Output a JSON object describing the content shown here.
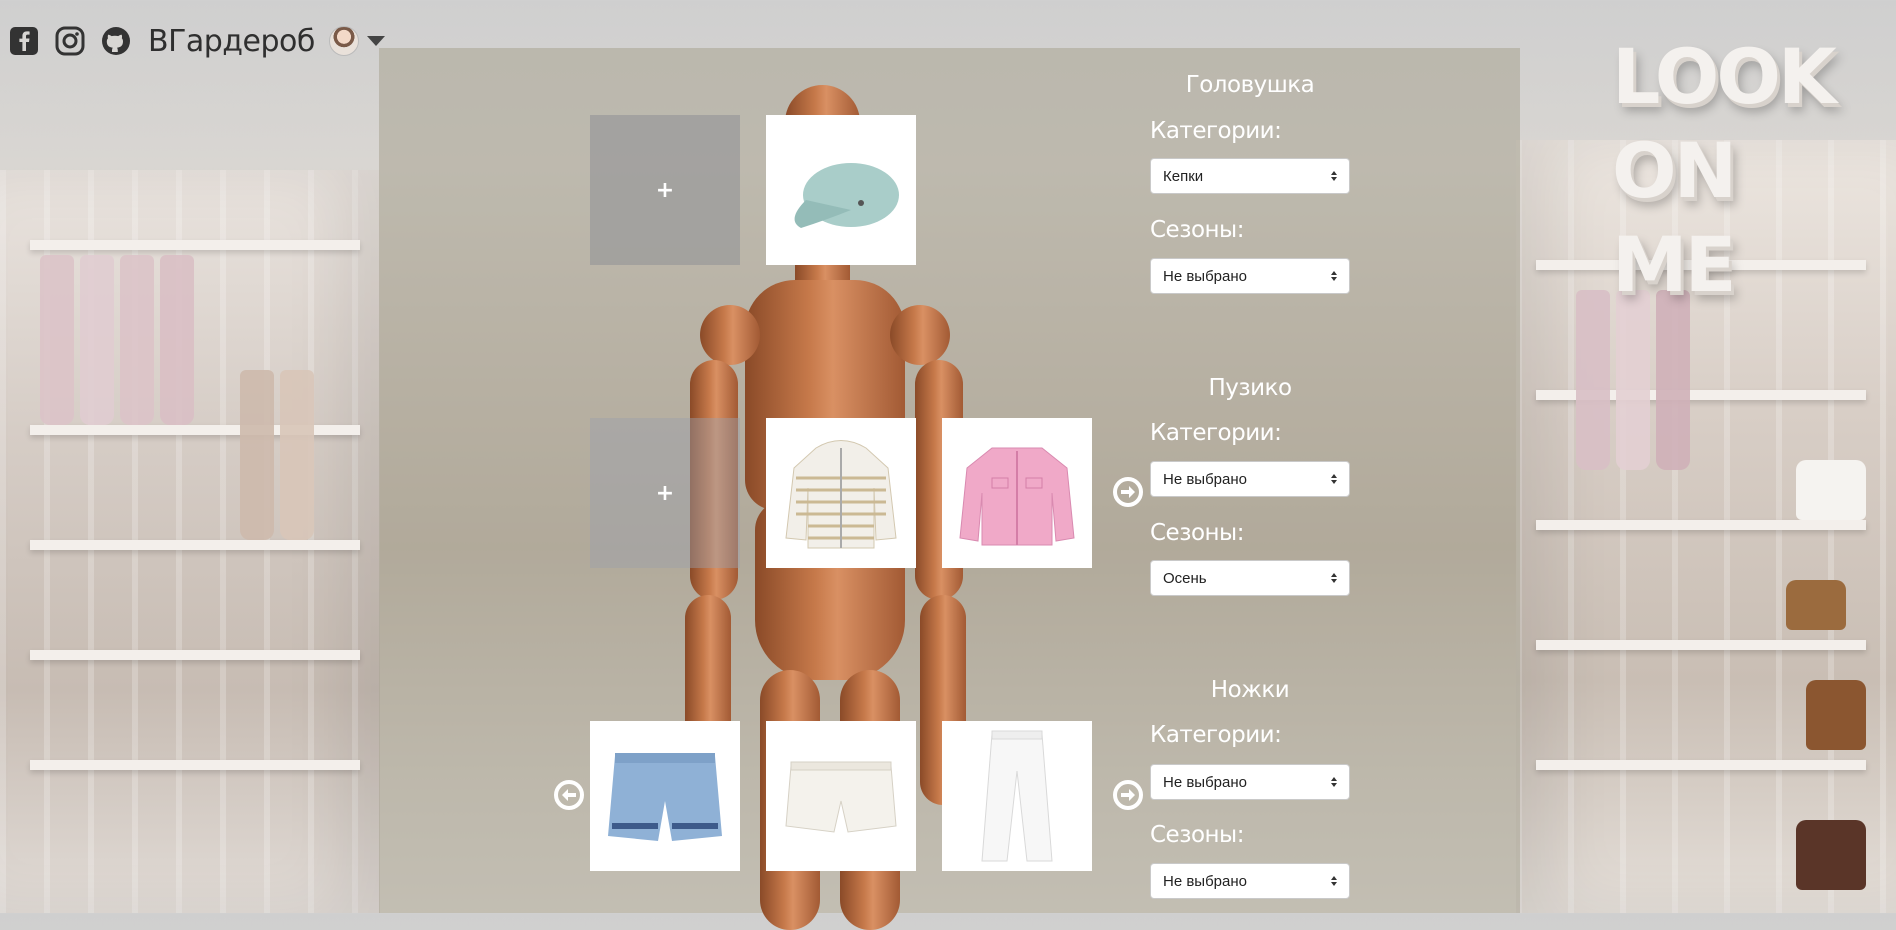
{
  "header": {
    "brand": "ВГардероб",
    "icons": [
      "facebook-icon",
      "instagram-icon",
      "github-icon"
    ]
  },
  "logo": [
    "LOOK",
    "ON",
    "ME"
  ],
  "sections": [
    {
      "title": "Головушка",
      "categories_label": "Категории:",
      "category_value": "Кепки",
      "seasons_label": "Сезоны:",
      "season_value": "Не выбрано"
    },
    {
      "title": "Пузико",
      "categories_label": "Категории:",
      "category_value": "Не выбрано",
      "seasons_label": "Сезоны:",
      "season_value": "Осень"
    },
    {
      "title": "Ножки",
      "categories_label": "Категории:",
      "category_value": "Не выбрано",
      "seasons_label": "Сезоны:",
      "season_value": "Не выбрано"
    }
  ],
  "add_tile": {
    "label": "+"
  },
  "colors": {
    "panel": "#aca898",
    "text": "#ffffff"
  }
}
